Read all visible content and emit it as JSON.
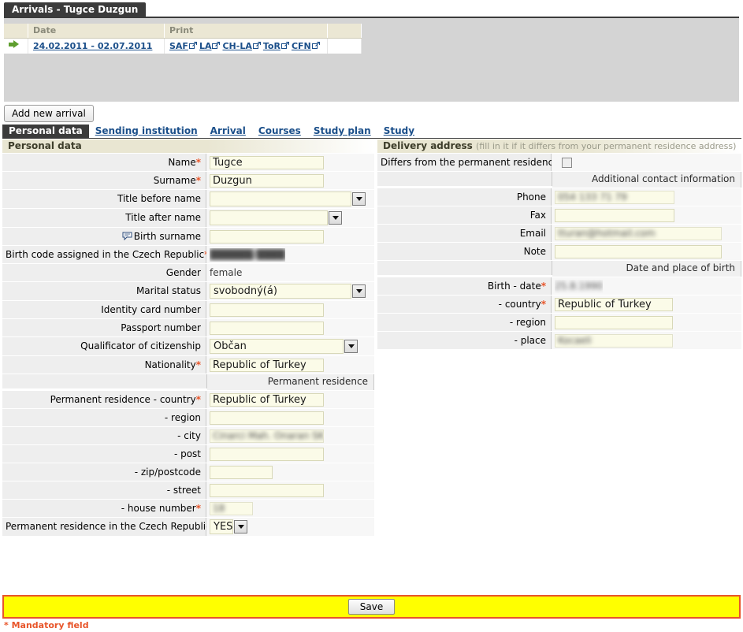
{
  "window": {
    "title": "Arrivals - Tugce Duzgun"
  },
  "arrivals_table": {
    "columns": [
      "",
      "Date",
      "Print",
      ""
    ],
    "rows": [
      {
        "arrow_icon": "green-arrow-icon",
        "date": "24.02.2011 - 02.07.2011",
        "print_links": [
          "SAF",
          "LA",
          "CH-LA",
          "ToR",
          "CFN"
        ]
      }
    ]
  },
  "toolbar": {
    "add_new_arrival": "Add new arrival"
  },
  "tabs": [
    {
      "label": "Personal data",
      "active": true
    },
    {
      "label": "Sending institution",
      "active": false
    },
    {
      "label": "Arrival",
      "active": false
    },
    {
      "label": "Courses",
      "active": false
    },
    {
      "label": "Study plan",
      "active": false
    },
    {
      "label": "Study",
      "active": false
    }
  ],
  "left": {
    "section_title": "Personal data",
    "fields": {
      "name": {
        "label": "Name",
        "required": true,
        "value": "Tugce"
      },
      "surname": {
        "label": "Surname",
        "required": true,
        "value": "Duzgun"
      },
      "title_before": {
        "label": "Title before name",
        "required": false,
        "value": ""
      },
      "title_after": {
        "label": "Title after name",
        "required": false,
        "value": ""
      },
      "birth_surname": {
        "label": "Birth surname",
        "required": false,
        "value": "",
        "icon": "comment-icon"
      },
      "birth_code": {
        "label": "Birth code assigned in the Czech Republic",
        "required": true,
        "value": "██████/████",
        "redacted": true
      },
      "gender": {
        "label": "Gender",
        "required": false,
        "value": "female"
      },
      "marital_status": {
        "label": "Marital status",
        "required": false,
        "value": "svobodný(á)"
      },
      "identity_card": {
        "label": "Identity card number",
        "required": false,
        "value": ""
      },
      "passport": {
        "label": "Passport number",
        "required": false,
        "value": ""
      },
      "citizenship_qualificator": {
        "label": "Qualificator of citizenship",
        "required": false,
        "value": "Občan"
      },
      "nationality": {
        "label": "Nationality",
        "required": true,
        "value": "Republic of Turkey"
      }
    },
    "permanent_residence": {
      "subtitle": "Permanent residence",
      "country": {
        "label": "Permanent residence - country",
        "required": true,
        "value": "Republic of Turkey"
      },
      "region": {
        "label": "- region",
        "required": false,
        "value": ""
      },
      "city": {
        "label": "- city",
        "required": false,
        "value": "Cinarci Mah. Onaran SK.",
        "redacted": true
      },
      "post": {
        "label": "- post",
        "required": false,
        "value": ""
      },
      "zip": {
        "label": "- zip/postcode",
        "required": false,
        "value": ""
      },
      "street": {
        "label": "- street",
        "required": false,
        "value": ""
      },
      "house_number": {
        "label": "- house number",
        "required": true,
        "value": "18",
        "redacted": true
      },
      "in_czech_republic": {
        "label": "Permanent residence in the Czech Republic",
        "required": false,
        "value": "YES"
      }
    }
  },
  "right": {
    "section_title": "Delivery address",
    "section_hint": "(fill in it if it differs from your permanent residence address)",
    "differs": {
      "label": "Differs from the permanent residence",
      "checked": false
    },
    "contact": {
      "subtitle": "Additional contact information",
      "phone": {
        "label": "Phone",
        "value": "054 133 71 79",
        "redacted": true
      },
      "fax": {
        "label": "Fax",
        "value": ""
      },
      "email": {
        "label": "Email",
        "value": "tturan@hotmail.com",
        "redacted": true
      },
      "note": {
        "label": "Note",
        "value": ""
      }
    },
    "birth": {
      "subtitle": "Date and place of birth",
      "date": {
        "label": "Birth - date",
        "required": true,
        "value": "25.8.1990",
        "redacted": true
      },
      "country": {
        "label": "- country",
        "required": true,
        "value": "Republic of Turkey"
      },
      "region": {
        "label": "- region",
        "required": false,
        "value": ""
      },
      "place": {
        "label": "- place",
        "required": false,
        "value": "Kocaeli",
        "redacted": true
      }
    }
  },
  "footer": {
    "save_label": "Save",
    "mandatory_note": "* Mandatory field"
  },
  "colors": {
    "title_bar": "#3b3b3b",
    "accent_link": "#1b4f8a",
    "required_star": "#e8552a",
    "save_bar_bg": "#ffff00",
    "save_bar_border": "#e8552a",
    "section_band": "#e9e6d2",
    "input_bg": "#fbfbe8"
  }
}
